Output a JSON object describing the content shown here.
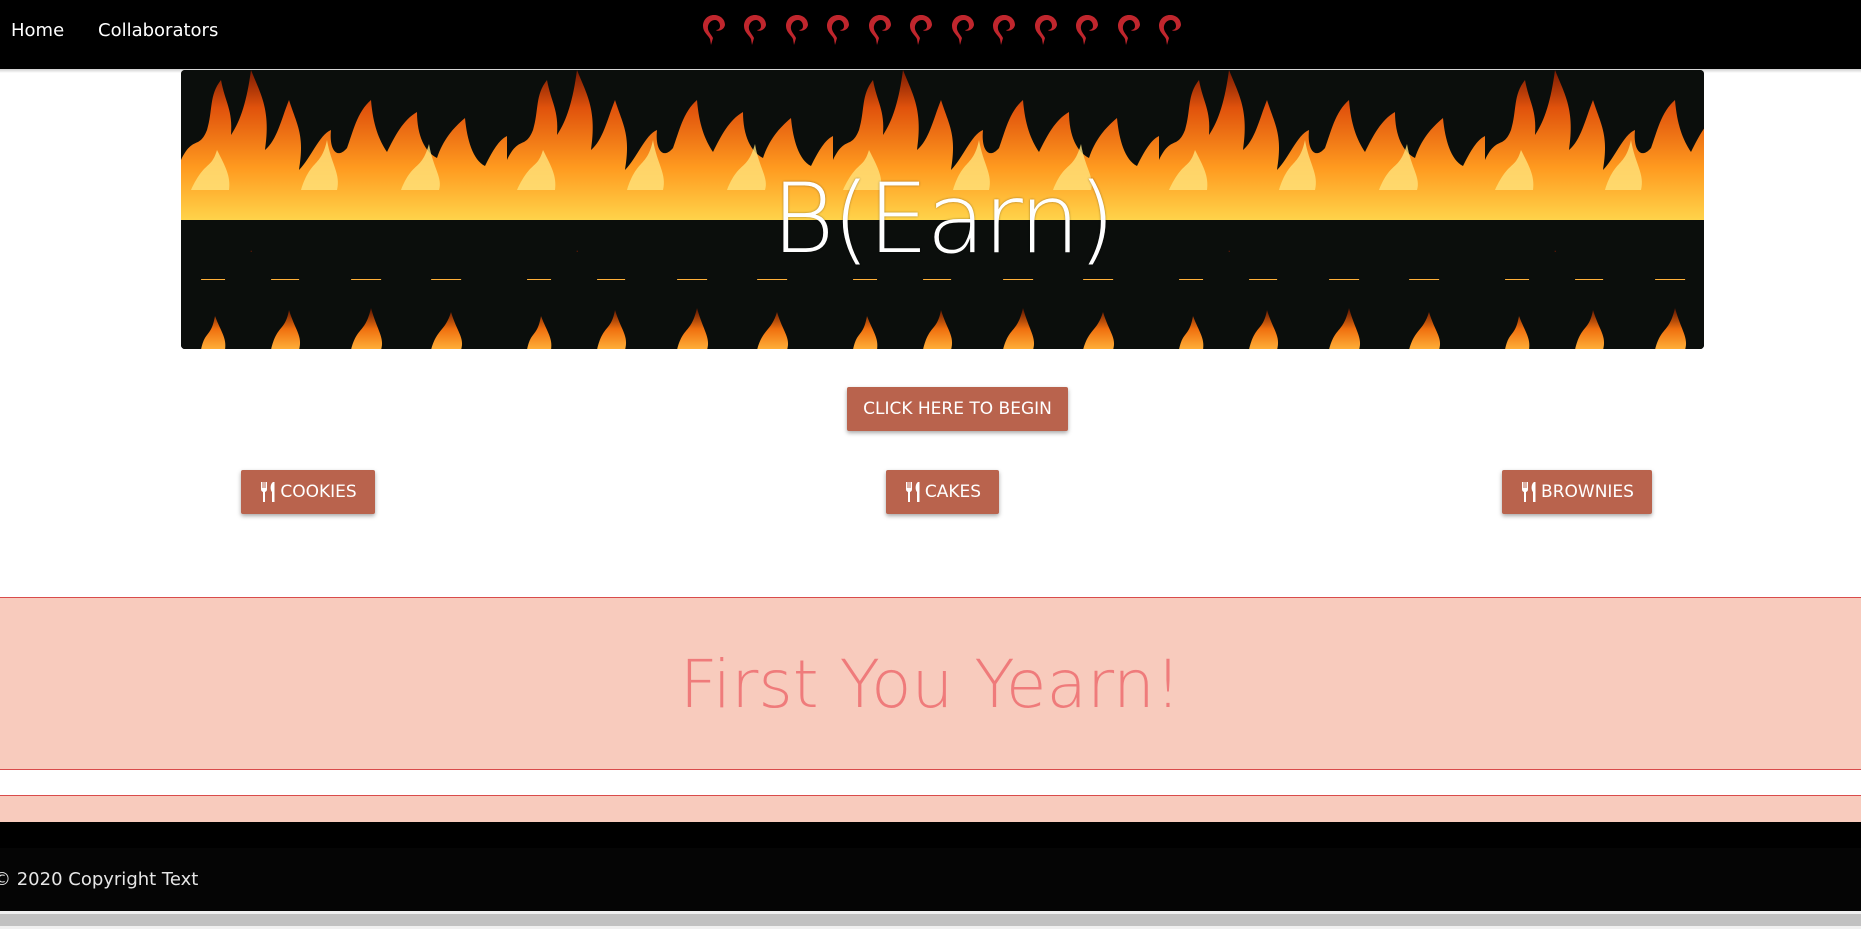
{
  "nav": {
    "links": [
      "Home",
      "Collaborators"
    ],
    "pin_icon": "map-pin-icon",
    "pin_color": "#c0262d",
    "pin_count": 12
  },
  "hero": {
    "title": "B(Earn)"
  },
  "cta": {
    "label": "CLICK HERE TO BEGIN"
  },
  "categories": [
    {
      "label": "COOKIES",
      "icon": "utensils-icon"
    },
    {
      "label": "CAKES",
      "icon": "utensils-icon"
    },
    {
      "label": "BROWNIES",
      "icon": "utensils-icon"
    }
  ],
  "banner": {
    "title": "First You Yearn!"
  },
  "footer": {
    "copyright": "© 2020 Copyright Text"
  },
  "colors": {
    "button": "#b9634d",
    "band": "#f8cbbd",
    "band_text": "#ef7b7b",
    "nav": "#000000"
  }
}
